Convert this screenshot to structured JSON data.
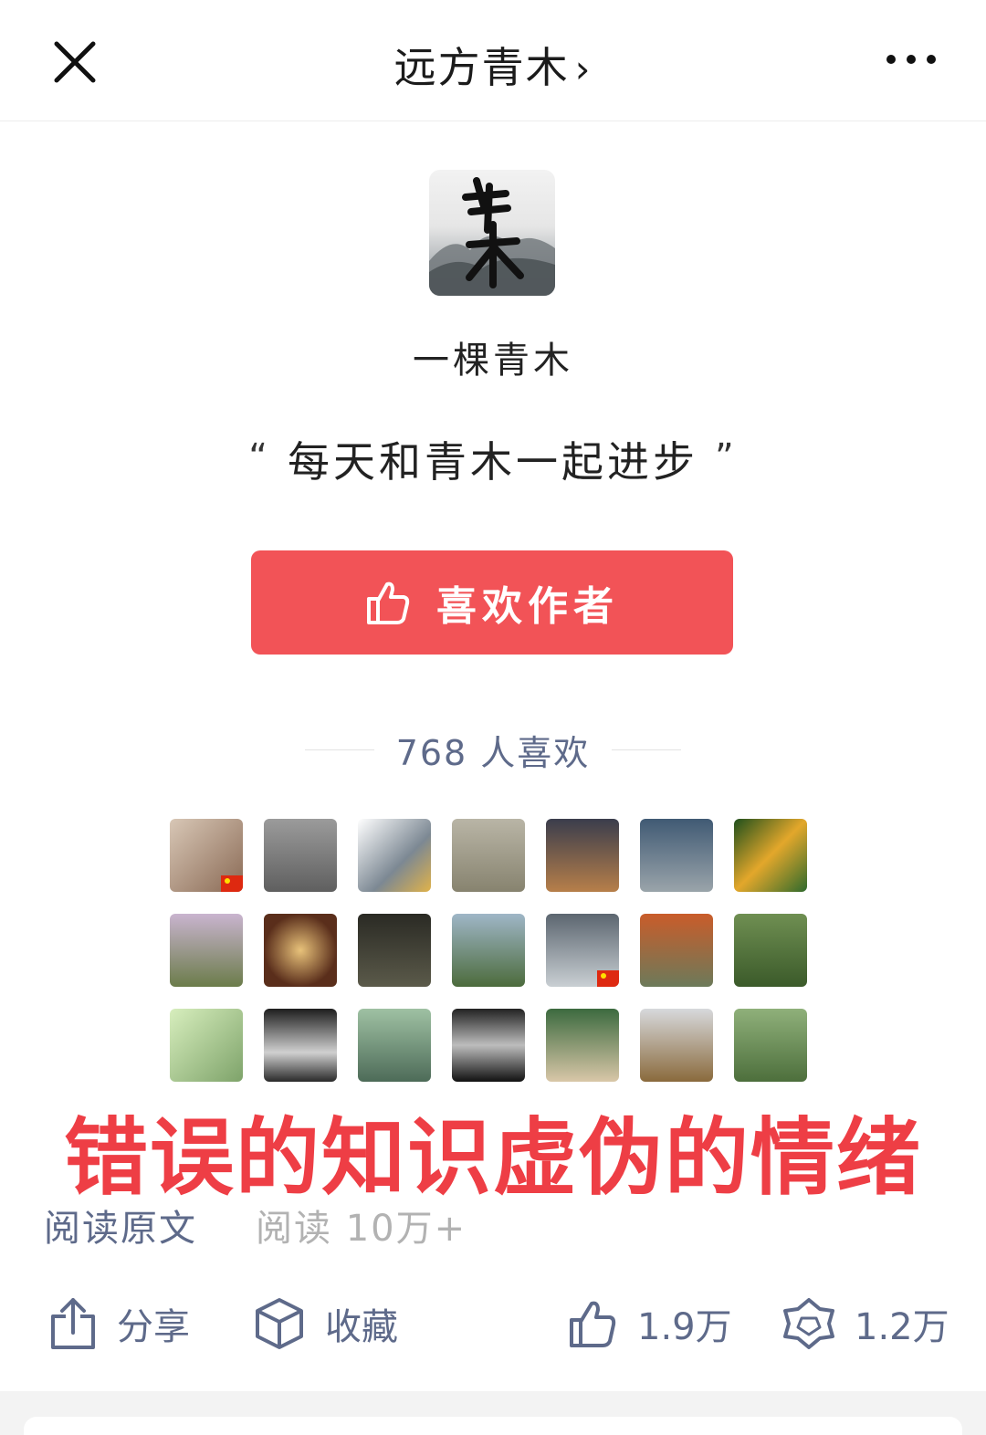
{
  "header": {
    "title": "远方青木",
    "chevron": "›"
  },
  "author": {
    "name": "一棵青木",
    "slogan": "每天和青木一起进步",
    "quote_open": "“",
    "quote_close": "”"
  },
  "like_button": {
    "label": "喜欢作者"
  },
  "likes": {
    "count_text": "768 人喜欢"
  },
  "avatars": [
    {
      "bg": "linear-gradient(135deg,#d8c7b6,#8a6a55)",
      "flag": true
    },
    {
      "bg": "linear-gradient(180deg,#9b9b9b,#5f5f5f)",
      "flag": false
    },
    {
      "bg": "linear-gradient(135deg,#ffffff,#7c8893 60%,#e0b24a)",
      "flag": false
    },
    {
      "bg": "linear-gradient(180deg,#b9b5a6,#87836f)",
      "flag": false
    },
    {
      "bg": "linear-gradient(180deg,#3a3d4c,#b77f4a)",
      "flag": false
    },
    {
      "bg": "linear-gradient(180deg,#405a74,#9aa4aa)",
      "flag": false
    },
    {
      "bg": "linear-gradient(135deg,#1e4f1c,#e3a72b 50%,#2f6a2d)",
      "flag": false
    },
    {
      "bg": "linear-gradient(180deg,#c9b4cf,#6b7c4a)",
      "flag": false
    },
    {
      "bg": "radial-gradient(circle,#e8c27a,#5a2e1b 70%)",
      "flag": false
    },
    {
      "bg": "linear-gradient(180deg,#2a2a24,#5b5a4a)",
      "flag": false
    },
    {
      "bg": "linear-gradient(180deg,#9fb6c7,#4c6b3c)",
      "flag": false
    },
    {
      "bg": "linear-gradient(180deg,#5c6670,#c9cfd3)",
      "flag": true
    },
    {
      "bg": "linear-gradient(180deg,#c95c2a,#6c7a5a)",
      "flag": false
    },
    {
      "bg": "linear-gradient(180deg,#6f8f52,#3b5a2a)",
      "flag": false
    },
    {
      "bg": "linear-gradient(135deg,#d7eebd,#7ea36a)",
      "flag": false
    },
    {
      "bg": "linear-gradient(180deg,#1e1e1e,#d0d0d0 60%,#2a2a2a)",
      "flag": false
    },
    {
      "bg": "linear-gradient(180deg,#9fc1a3,#4d6b58)",
      "flag": false
    },
    {
      "bg": "linear-gradient(180deg,#222,#bdbdbd 50%,#111)",
      "flag": false
    },
    {
      "bg": "linear-gradient(180deg,#3c6a3f,#d9c7a8)",
      "flag": false
    },
    {
      "bg": "linear-gradient(180deg,#d7d9dc,#8a6a3c)",
      "flag": false
    },
    {
      "bg": "linear-gradient(180deg,#8fb07a,#4d6f3c)",
      "flag": false
    }
  ],
  "overlay": {
    "text": "错误的知识虚伪的情绪"
  },
  "reading": {
    "read_original": "阅读原文",
    "read_count": "阅读 10万+"
  },
  "actions": {
    "share": "分享",
    "favorite": "收藏",
    "like": "1.9万",
    "wow": "1.2万"
  },
  "colors": {
    "accent": "#f25357",
    "link": "#5e6a8a",
    "overlay": "#ee3e45"
  }
}
